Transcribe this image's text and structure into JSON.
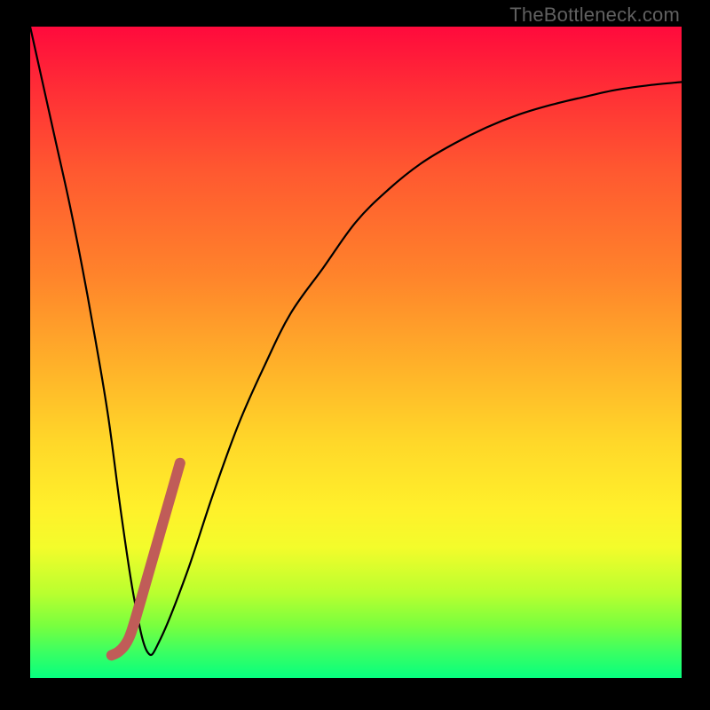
{
  "watermark": "TheBottleneck.com",
  "chart_data": {
    "type": "line",
    "title": "",
    "xlabel": "",
    "ylabel": "",
    "xlim": [
      0,
      100
    ],
    "ylim": [
      0,
      100
    ],
    "series": [
      {
        "name": "bottleneck-curve",
        "x": [
          0,
          2,
          4,
          6,
          8,
          10,
          12,
          14,
          16,
          18,
          20,
          24,
          28,
          32,
          36,
          40,
          45,
          50,
          55,
          60,
          65,
          70,
          75,
          80,
          85,
          90,
          95,
          100
        ],
        "values": [
          100,
          91,
          82,
          73,
          63,
          52,
          40,
          25,
          12,
          4,
          6,
          16,
          28,
          39,
          48,
          56,
          63,
          70,
          75,
          79,
          82,
          84.5,
          86.5,
          88,
          89.2,
          90.3,
          91,
          91.5
        ]
      },
      {
        "name": "highlight-segment",
        "x": [
          12.5,
          13.5,
          14.5,
          15.5,
          17,
          19,
          21,
          23
        ],
        "values": [
          3.5,
          4.0,
          5.0,
          7.0,
          12,
          19,
          26,
          33
        ]
      }
    ],
    "gradient_colors": {
      "top": "#ff0a3c",
      "mid": "#ffe02a",
      "bottom": "#06ff7f"
    },
    "highlight_color": "#c05c58"
  }
}
